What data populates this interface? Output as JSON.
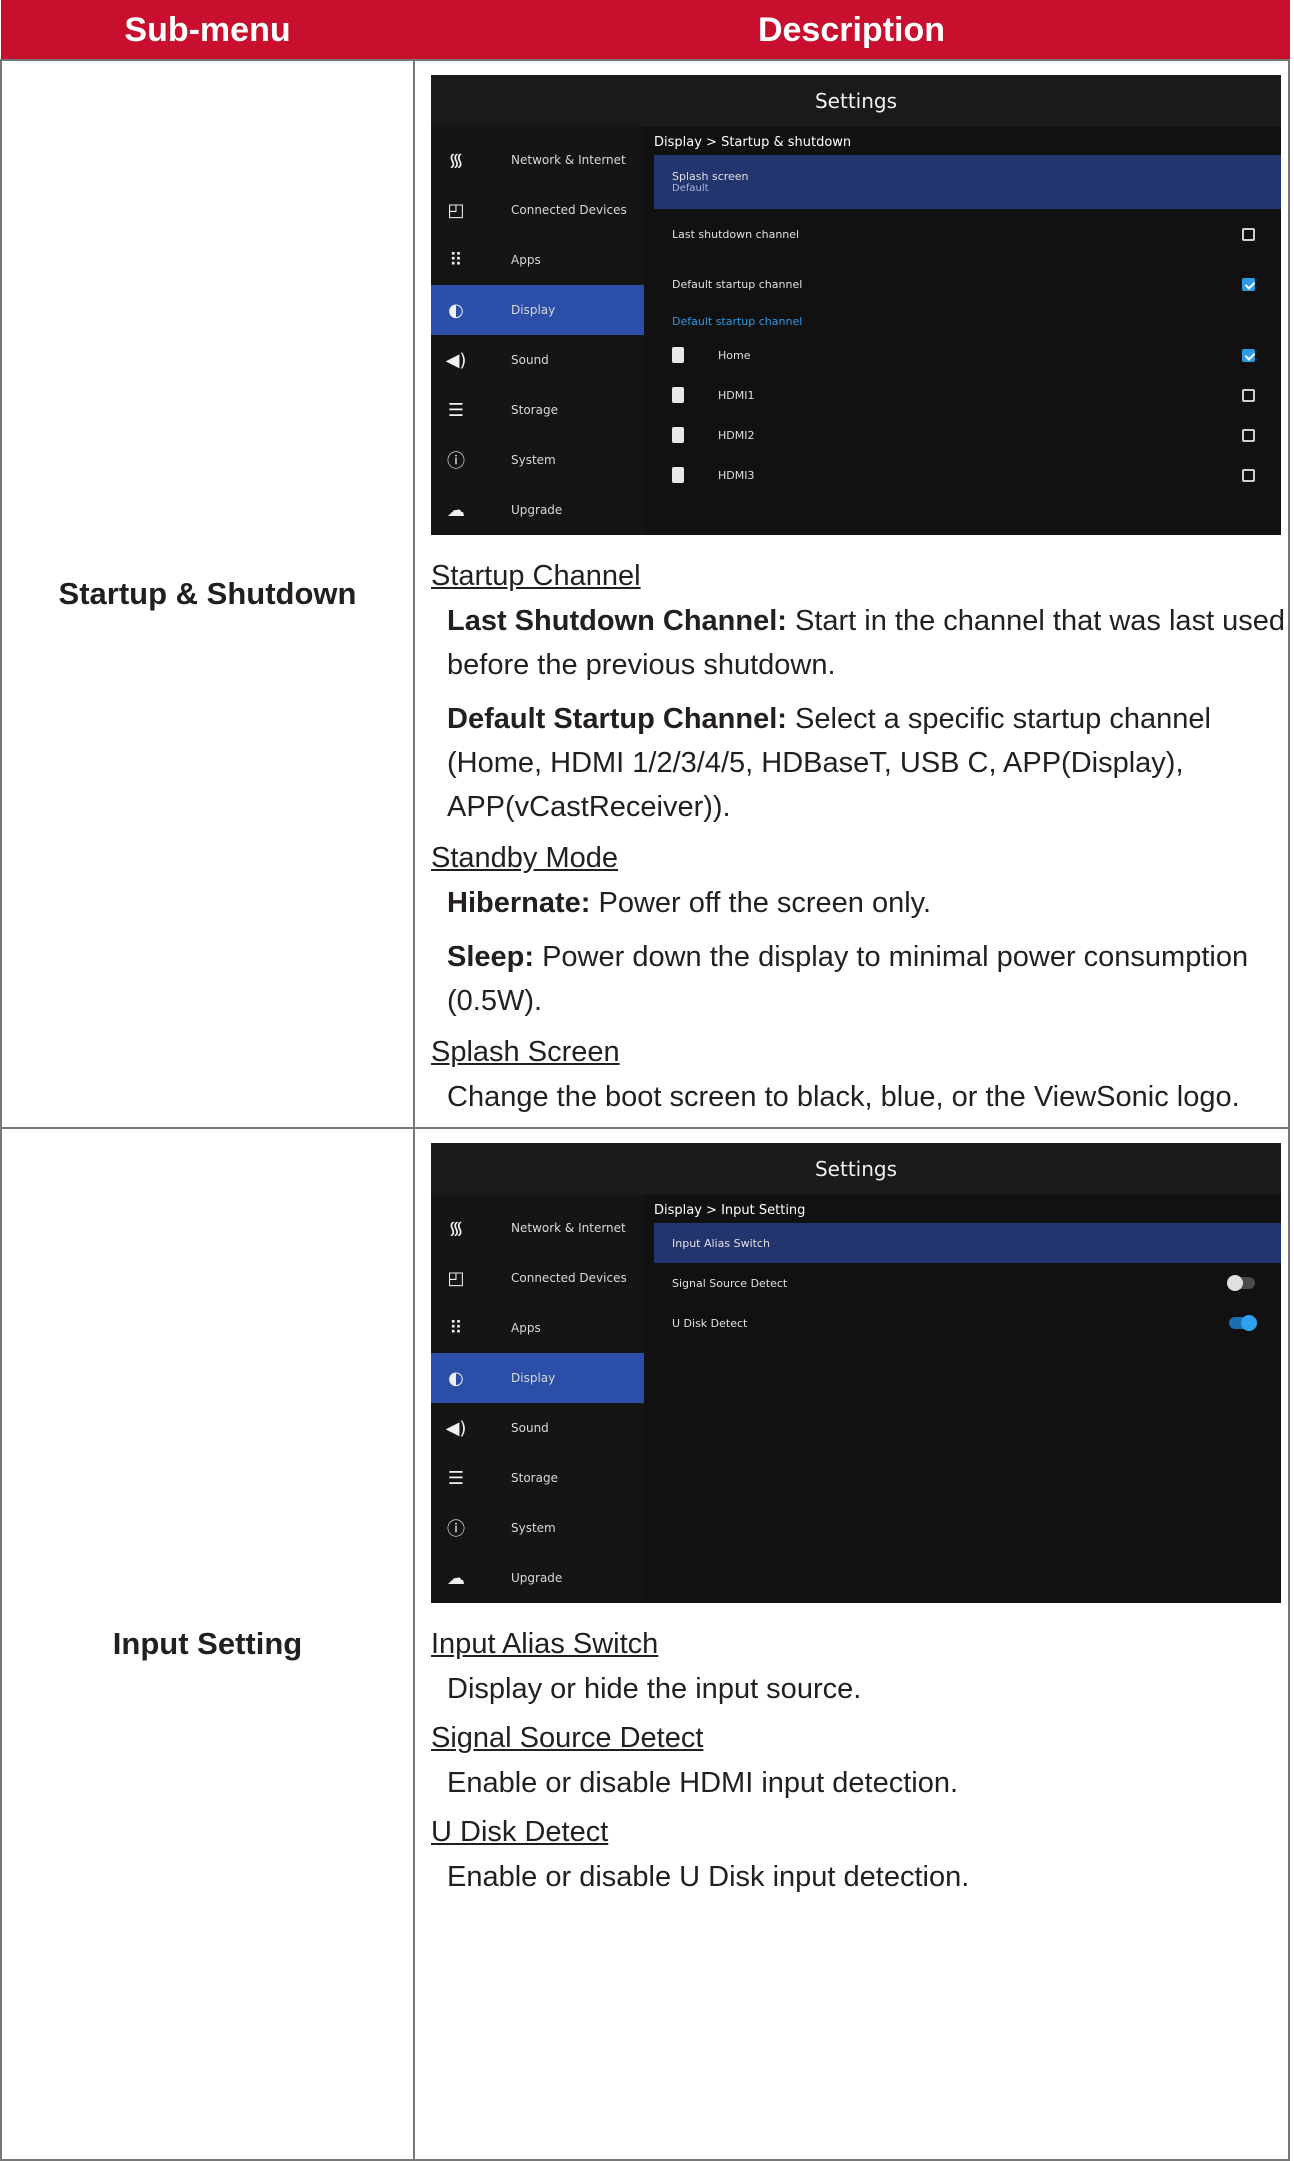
{
  "table": {
    "headers": [
      "Sub-menu",
      "Description"
    ]
  },
  "rows": [
    {
      "submenu": "Startup & Shutdown",
      "screenshot": {
        "title": "Settings",
        "sidebar": [
          "Network & Internet",
          "Connected Devices",
          "Apps",
          "Display",
          "Sound",
          "Storage",
          "System",
          "Upgrade"
        ],
        "active_sidebar": "Display",
        "breadcrumb": "Display > Startup & shutdown",
        "selected_item": {
          "label": "Splash screen",
          "value": "Default"
        },
        "options": [
          {
            "label": "Last shutdown channel",
            "checked": false
          },
          {
            "label": "Default startup channel",
            "checked": true
          }
        ],
        "section_label": "Default startup channel",
        "channels": [
          {
            "label": "Home",
            "checked": true
          },
          {
            "label": "HDMI1",
            "checked": false
          },
          {
            "label": "HDMI2",
            "checked": false
          },
          {
            "label": "HDMI3",
            "checked": false
          }
        ]
      },
      "sections": [
        {
          "heading": "Startup Channel",
          "items": [
            {
              "term": "Last Shutdown Channel:",
              "text": " Start in the channel that was last used before the previous shutdown."
            },
            {
              "term": "Default Startup Channel:",
              "text": " Select a specific startup channel (Home, HDMI 1/2/3/4/5, HDBaseT, USB C, APP(Display), APP(vCastReceiver))."
            }
          ]
        },
        {
          "heading": "Standby Mode",
          "items": [
            {
              "term": "Hibernate:",
              "text": " Power off the screen only."
            },
            {
              "term": "Sleep:",
              "text": " Power down the display to minimal power consumption (0.5W)."
            }
          ]
        },
        {
          "heading": "Splash Screen",
          "plain": "Change the boot screen to black, blue, or the ViewSonic logo."
        }
      ]
    },
    {
      "submenu": "Input Setting",
      "screenshot": {
        "title": "Settings",
        "sidebar": [
          "Network & Internet",
          "Connected Devices",
          "Apps",
          "Display",
          "Sound",
          "Storage",
          "System",
          "Upgrade"
        ],
        "active_sidebar": "Display",
        "breadcrumb": "Display > Input Setting",
        "selected_item": {
          "label": "Input Alias Switch"
        },
        "toggles": [
          {
            "label": "Signal Source Detect",
            "on": false
          },
          {
            "label": "U Disk Detect",
            "on": true
          }
        ]
      },
      "sections": [
        {
          "heading": "Input Alias Switch",
          "plain": "Display or hide the input source."
        },
        {
          "heading": "Signal Source Detect",
          "plain": "Enable or disable HDMI input detection."
        },
        {
          "heading": "U Disk Detect",
          "plain": "Enable or disable U Disk input detection."
        }
      ]
    }
  ],
  "colors": {
    "header_bg": "#c8102e",
    "accent_blue": "#2e9ae6",
    "active_blue": "#2b4fa8"
  },
  "icons": [
    "wifi-icon",
    "connected-devices-icon",
    "apps-grid-icon",
    "display-brightness-icon",
    "sound-icon",
    "storage-icon",
    "system-info-icon",
    "upgrade-cloud-icon",
    "hdmi-port-icon"
  ]
}
